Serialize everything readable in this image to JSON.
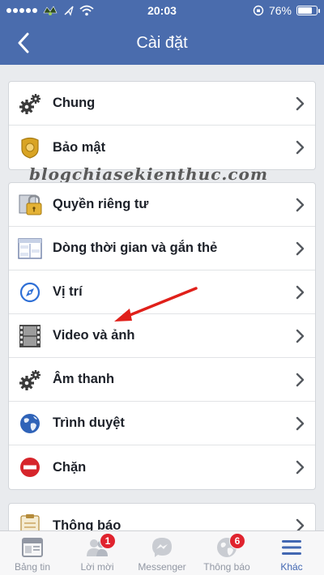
{
  "status_bar": {
    "time": "20:03",
    "battery": "76%",
    "battery_level": 0.76
  },
  "nav": {
    "title": "Cài đặt",
    "back_icon": "chevron-left-icon"
  },
  "watermark": "blogchiasekienthuc.com",
  "groups": [
    {
      "items": [
        {
          "label": "Chung",
          "icon": "gears-icon"
        },
        {
          "label": "Bảo mật",
          "icon": "shield-badge-icon"
        }
      ]
    },
    {
      "items": [
        {
          "label": "Quyền riêng tư",
          "icon": "padlock-icon"
        },
        {
          "label": "Dòng thời gian và gắn thẻ",
          "icon": "timeline-icon"
        },
        {
          "label": "Vị trí",
          "icon": "compass-icon"
        },
        {
          "label": "Video và ảnh",
          "icon": "film-strip-icon"
        },
        {
          "label": "Âm thanh",
          "icon": "gears-icon"
        },
        {
          "label": "Trình duyệt",
          "icon": "globe-icon"
        },
        {
          "label": "Chặn",
          "icon": "block-icon"
        }
      ]
    },
    {
      "items": [
        {
          "label": "Thông báo",
          "icon": "clipboard-icon"
        }
      ]
    }
  ],
  "tabbar": {
    "tabs": [
      {
        "label": "Bảng tin",
        "icon": "news-feed-icon",
        "badge": ""
      },
      {
        "label": "Lời mời",
        "icon": "friend-requests-icon",
        "badge": "1"
      },
      {
        "label": "Messenger",
        "icon": "messenger-icon",
        "badge": ""
      },
      {
        "label": "Thông báo",
        "icon": "globe-notifications-icon",
        "badge": "6"
      },
      {
        "label": "Khác",
        "icon": "menu-icon",
        "badge": ""
      }
    ],
    "active_index": 4
  },
  "colors": {
    "header": "#4a6cad",
    "active_tab": "#4267b2",
    "badge": "#e0232e",
    "annotation_arrow": "#e0201a"
  }
}
